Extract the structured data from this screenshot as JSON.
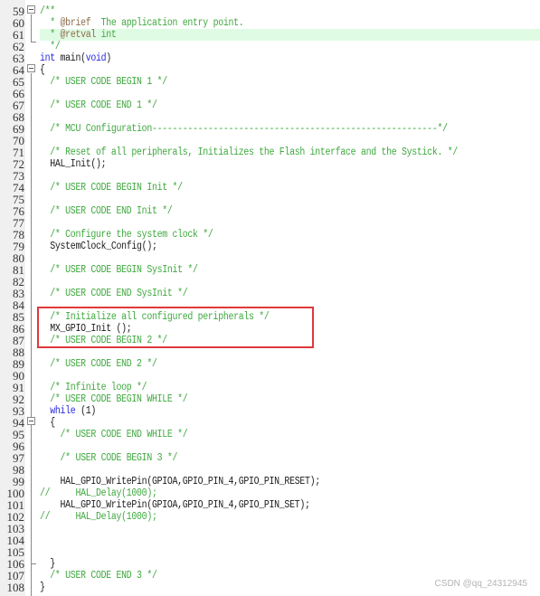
{
  "editor": {
    "lines": [
      {
        "n": "59",
        "parts": [
          {
            "t": "/**",
            "c": "cm"
          }
        ]
      },
      {
        "n": "60",
        "parts": [
          {
            "t": "  * ",
            "c": "cm"
          },
          {
            "t": "@brief",
            "c": "tag"
          },
          {
            "t": "  The application entry point.",
            "c": "cm"
          }
        ]
      },
      {
        "n": "61",
        "parts": [
          {
            "t": "  * ",
            "c": "cm"
          },
          {
            "t": "@retval",
            "c": "tag"
          },
          {
            "t": " int",
            "c": "cm"
          }
        ],
        "highlight": true
      },
      {
        "n": "62",
        "parts": [
          {
            "t": "  */",
            "c": "cm"
          }
        ]
      },
      {
        "n": "63",
        "parts": [
          {
            "t": "int",
            "c": "kw"
          },
          {
            "t": " main(",
            "c": ""
          },
          {
            "t": "void",
            "c": "kw"
          },
          {
            "t": ")",
            "c": ""
          }
        ]
      },
      {
        "n": "64",
        "parts": [
          {
            "t": "{",
            "c": ""
          }
        ]
      },
      {
        "n": "65",
        "parts": [
          {
            "t": "  /* USER CODE BEGIN 1 */",
            "c": "cm"
          }
        ]
      },
      {
        "n": "66",
        "parts": []
      },
      {
        "n": "67",
        "parts": [
          {
            "t": "  /* USER CODE END 1 */",
            "c": "cm"
          }
        ]
      },
      {
        "n": "68",
        "parts": []
      },
      {
        "n": "69",
        "parts": [
          {
            "t": "  /* MCU Configuration--------------------------------------------------------*/",
            "c": "cm"
          }
        ]
      },
      {
        "n": "70",
        "parts": []
      },
      {
        "n": "71",
        "parts": [
          {
            "t": "  /* Reset of all peripherals, Initializes the Flash interface and the Systick. */",
            "c": "cm"
          }
        ]
      },
      {
        "n": "72",
        "parts": [
          {
            "t": "  HAL_Init();",
            "c": ""
          }
        ]
      },
      {
        "n": "73",
        "parts": []
      },
      {
        "n": "74",
        "parts": [
          {
            "t": "  /* USER CODE BEGIN Init */",
            "c": "cm"
          }
        ]
      },
      {
        "n": "75",
        "parts": []
      },
      {
        "n": "76",
        "parts": [
          {
            "t": "  /* USER CODE END Init */",
            "c": "cm"
          }
        ]
      },
      {
        "n": "77",
        "parts": []
      },
      {
        "n": "78",
        "parts": [
          {
            "t": "  /* Configure the system clock */",
            "c": "cm"
          }
        ]
      },
      {
        "n": "79",
        "parts": [
          {
            "t": "  SystemClock_Config();",
            "c": ""
          }
        ]
      },
      {
        "n": "80",
        "parts": []
      },
      {
        "n": "81",
        "parts": [
          {
            "t": "  /* USER CODE BEGIN SysInit */",
            "c": "cm"
          }
        ]
      },
      {
        "n": "82",
        "parts": []
      },
      {
        "n": "83",
        "parts": [
          {
            "t": "  /* USER CODE END SysInit */",
            "c": "cm"
          }
        ]
      },
      {
        "n": "84",
        "parts": []
      },
      {
        "n": "85",
        "parts": [
          {
            "t": "  /* Initialize all configured peripherals */",
            "c": "cm"
          }
        ]
      },
      {
        "n": "86",
        "parts": [
          {
            "t": "  MX_GPIO_Init ();",
            "c": ""
          }
        ]
      },
      {
        "n": "87",
        "parts": [
          {
            "t": "  /* USER CODE BEGIN 2 */",
            "c": "cm"
          }
        ]
      },
      {
        "n": "88",
        "parts": []
      },
      {
        "n": "89",
        "parts": [
          {
            "t": "  /* USER CODE END 2 */",
            "c": "cm"
          }
        ]
      },
      {
        "n": "90",
        "parts": []
      },
      {
        "n": "91",
        "parts": [
          {
            "t": "  /* Infinite loop */",
            "c": "cm"
          }
        ]
      },
      {
        "n": "92",
        "parts": [
          {
            "t": "  /* USER CODE BEGIN WHILE */",
            "c": "cm"
          }
        ]
      },
      {
        "n": "93",
        "parts": [
          {
            "t": "  ",
            "c": ""
          },
          {
            "t": "while",
            "c": "kw"
          },
          {
            "t": " (1)",
            "c": ""
          }
        ]
      },
      {
        "n": "94",
        "parts": [
          {
            "t": "  {",
            "c": ""
          }
        ]
      },
      {
        "n": "95",
        "parts": [
          {
            "t": "    /* USER CODE END WHILE */",
            "c": "cm"
          }
        ]
      },
      {
        "n": "96",
        "parts": []
      },
      {
        "n": "97",
        "parts": [
          {
            "t": "    /* USER CODE BEGIN 3 */",
            "c": "cm"
          }
        ]
      },
      {
        "n": "98",
        "parts": []
      },
      {
        "n": "99",
        "parts": [
          {
            "t": "    HAL_GPIO_WritePin(GPIOA,GPIO_PIN_4,GPIO_PIN_RESET);",
            "c": ""
          }
        ]
      },
      {
        "n": "100",
        "parts": [
          {
            "t": "//     HAL_Delay(1000);",
            "c": "cm"
          }
        ]
      },
      {
        "n": "101",
        "parts": [
          {
            "t": "    HAL_GPIO_WritePin(GPIOA,GPIO_PIN_4,GPIO_PIN_SET);",
            "c": ""
          }
        ]
      },
      {
        "n": "102",
        "parts": [
          {
            "t": "//     HAL_Delay(1000);",
            "c": "cm"
          }
        ]
      },
      {
        "n": "103",
        "parts": []
      },
      {
        "n": "104",
        "parts": []
      },
      {
        "n": "105",
        "parts": []
      },
      {
        "n": "106",
        "parts": [
          {
            "t": "  }",
            "c": ""
          }
        ]
      },
      {
        "n": "107",
        "parts": [
          {
            "t": "  /* USER CODE END 3 */",
            "c": "cm"
          }
        ]
      },
      {
        "n": "108",
        "parts": [
          {
            "t": "}",
            "c": ""
          }
        ]
      }
    ],
    "highlighted_block_lines": [
      "85",
      "86",
      "87"
    ]
  },
  "colors": {
    "comment": "#3fa83f",
    "keyword": "#2a2adf",
    "doc_tag": "#8b6b4a",
    "current_line_bg": "#e0fbe3",
    "annotation_box": "#e0393b"
  },
  "watermark": "CSDN @qq_24312945"
}
